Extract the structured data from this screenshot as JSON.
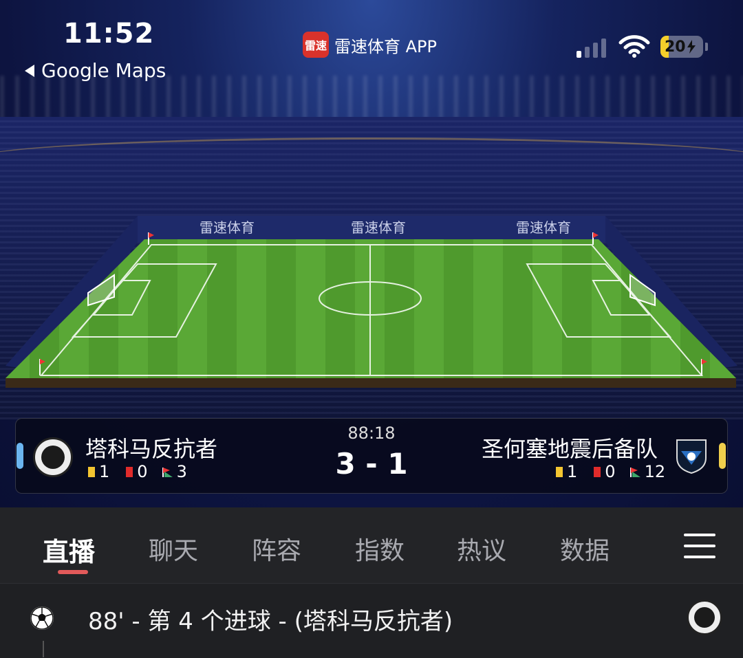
{
  "status_bar": {
    "time": "11:52",
    "back_label": "Google Maps",
    "app_icon_text": "雷速",
    "app_name": "雷速体育 APP",
    "battery": "20",
    "battery_level": 0.2,
    "signal_bars_active": 1
  },
  "pitch": {
    "board_text": "雷速体育",
    "icons": [
      "goal-icon",
      "corner-flag-icon"
    ]
  },
  "match": {
    "clock": "88:18",
    "score": "3 - 1",
    "home": {
      "name": "塔科马反抗者",
      "yellow": "1",
      "red": "0",
      "corners": "3",
      "side_color": "#6bb5f0"
    },
    "away": {
      "name": "圣何塞地震后备队",
      "yellow": "1",
      "red": "0",
      "corners": "12",
      "side_color": "#f0cf4c"
    }
  },
  "tabs": {
    "items": [
      {
        "label": "直播",
        "active": true
      },
      {
        "label": "聊天"
      },
      {
        "label": "阵容"
      },
      {
        "label": "指数"
      },
      {
        "label": "热议"
      },
      {
        "label": "数据"
      }
    ],
    "accent": "#e25a5a"
  },
  "feed": {
    "events": [
      {
        "text": "88' - 第 4 个进球 - (塔科马反抗者)",
        "icon": "soccer-ball-icon"
      }
    ]
  }
}
